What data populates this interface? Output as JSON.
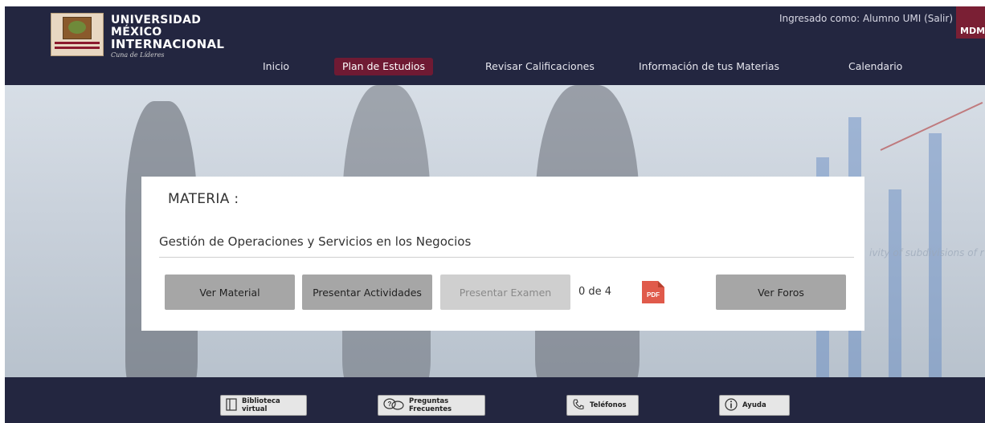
{
  "header": {
    "university_line1": "UNIVERSIDAD",
    "university_line2": "MÉXICO",
    "university_line3": "INTERNACIONAL",
    "motto": "Cuna de Líderes",
    "user_info": "Ingresado como: Alumno UMI (Salir)",
    "badge": "MDM"
  },
  "nav": {
    "items": [
      {
        "label": "Inicio"
      },
      {
        "label": "Plan de Estudios"
      },
      {
        "label": "Revisar Calificaciones"
      },
      {
        "label": "Información de tus Materias"
      },
      {
        "label": "Calendario"
      }
    ],
    "active_index": 1
  },
  "hero": {
    "background_text": "ivity of subdivisions of r"
  },
  "card": {
    "materia_label": "MATERIA :",
    "course_name": "Gestión de Operaciones y Servicios en los Negocios",
    "buttons": {
      "ver_material": "Ver Material",
      "presentar_actividades": "Presentar Actividades",
      "presentar_examen": "Presentar Examen",
      "ver_foros": "Ver Foros"
    },
    "exam_counter": "0 de 4",
    "pdf_label": "PDF"
  },
  "footer": {
    "items": [
      {
        "label": "Biblioteca virtual",
        "icon": "book-icon"
      },
      {
        "label": "Preguntas Frecuentes",
        "icon": "chat-bubbles-icon"
      },
      {
        "label": "Teléfonos",
        "icon": "phone-icon"
      },
      {
        "label": "Ayuda",
        "icon": "info-icon"
      }
    ]
  },
  "colors": {
    "header_bg": "#232640",
    "accent": "#6f1a33",
    "button_bg": "#a6a6a6",
    "button_disabled": "#cfcfcf",
    "pdf_red": "#e05a4b"
  }
}
